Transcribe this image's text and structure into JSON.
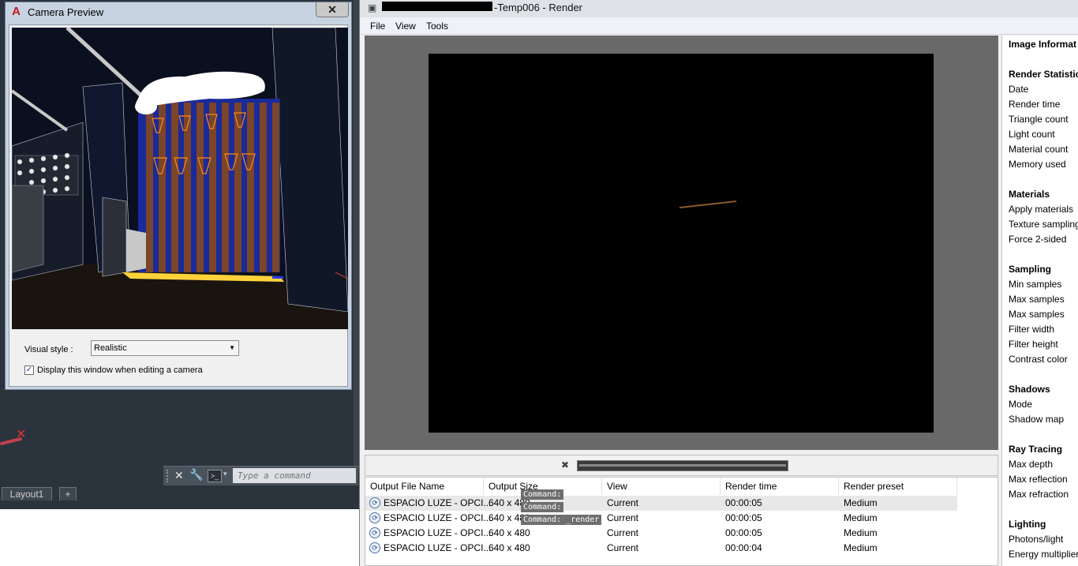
{
  "camera_preview": {
    "title": "Camera Preview",
    "close_symbol": "✕",
    "visual_style_label": "Visual style :",
    "visual_style_value": "Realistic",
    "display_checkbox_label": "Display this window when editing a camera",
    "display_checkbox_checked": true
  },
  "autocad": {
    "command_placeholder": "Type a command",
    "layout_tab": "Layout1",
    "add_tab": "+"
  },
  "render": {
    "title": "-Temp006 - Render",
    "menu": [
      "File",
      "View",
      "Tools"
    ],
    "table": {
      "headers": [
        "Output File Name",
        "Output Size",
        "View",
        "Render time",
        "Render preset"
      ],
      "rows": [
        {
          "file": "ESPACIO LUZE - OPCI...",
          "size": "640 x 480",
          "view": "Current",
          "time": "00:00:05",
          "preset": "Medium"
        },
        {
          "file": "ESPACIO LUZE - OPCI...",
          "size": "640 x 480",
          "view": "Current",
          "time": "00:00:05",
          "preset": "Medium"
        },
        {
          "file": "ESPACIO LUZE - OPCI...",
          "size": "640 x 480",
          "view": "Current",
          "time": "00:00:05",
          "preset": "Medium"
        },
        {
          "file": "ESPACIO LUZE - OPCI...",
          "size": "640 x 480",
          "view": "Current",
          "time": "00:00:04",
          "preset": "Medium"
        }
      ]
    },
    "command_history": [
      "Command:",
      "Command:",
      "Command: _render"
    ]
  },
  "stats": {
    "image_info": "Image Informat",
    "sections": [
      {
        "heading": "Render Statistic",
        "items": [
          "Date",
          "Render time",
          "Triangle count",
          "Light count",
          "Material count",
          "Memory used"
        ]
      },
      {
        "heading": "Materials",
        "items": [
          "Apply materials",
          "Texture sampling",
          "Force 2-sided"
        ]
      },
      {
        "heading": "Sampling",
        "items": [
          "Min samples",
          "Max samples",
          "Max samples",
          "Filter width",
          "Filter height",
          "Contrast color"
        ]
      },
      {
        "heading": "Shadows",
        "items": [
          "Mode",
          "Shadow map"
        ]
      },
      {
        "heading": "Ray Tracing",
        "items": [
          "Max depth",
          "Max reflection",
          "Max refraction"
        ]
      },
      {
        "heading": "Lighting",
        "items": [
          "Photons/light",
          "Energy multiplier"
        ]
      }
    ]
  },
  "colors": {
    "render_background": "#696969",
    "render_image": "#000000",
    "acad_background": "#2b333d",
    "render_line": "#8a5a2a"
  }
}
